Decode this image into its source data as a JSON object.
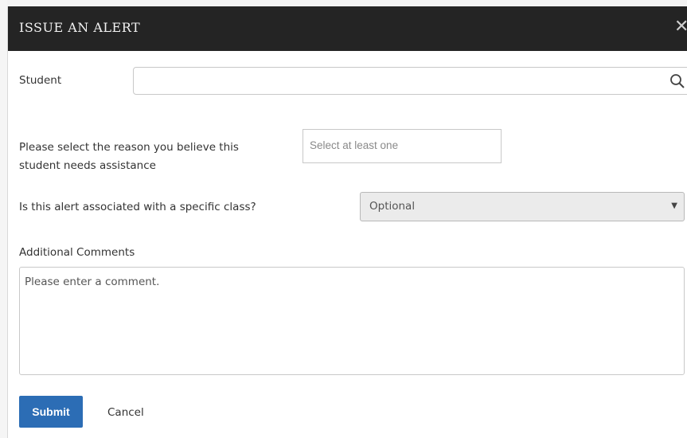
{
  "dialog": {
    "title": "ISSUE AN ALERT",
    "close_symbol": "✕"
  },
  "student": {
    "label": "Student",
    "value": "",
    "placeholder": ""
  },
  "reason": {
    "label_line1": "Please select the reason you believe this",
    "label_line2": "student needs assistance",
    "placeholder": "Select at least one"
  },
  "class_select": {
    "label": "Is this alert associated with a specific class?",
    "selected": "Optional",
    "caret": "▼"
  },
  "comments": {
    "label": "Additional Comments",
    "placeholder": "Please enter a comment."
  },
  "actions": {
    "submit_label": "Submit",
    "cancel_label": "Cancel"
  },
  "colors": {
    "header_bg": "#242424",
    "submit_bg": "#2c6db5"
  },
  "icons": [
    "close-icon",
    "search-icon",
    "chevron-down-icon"
  ]
}
